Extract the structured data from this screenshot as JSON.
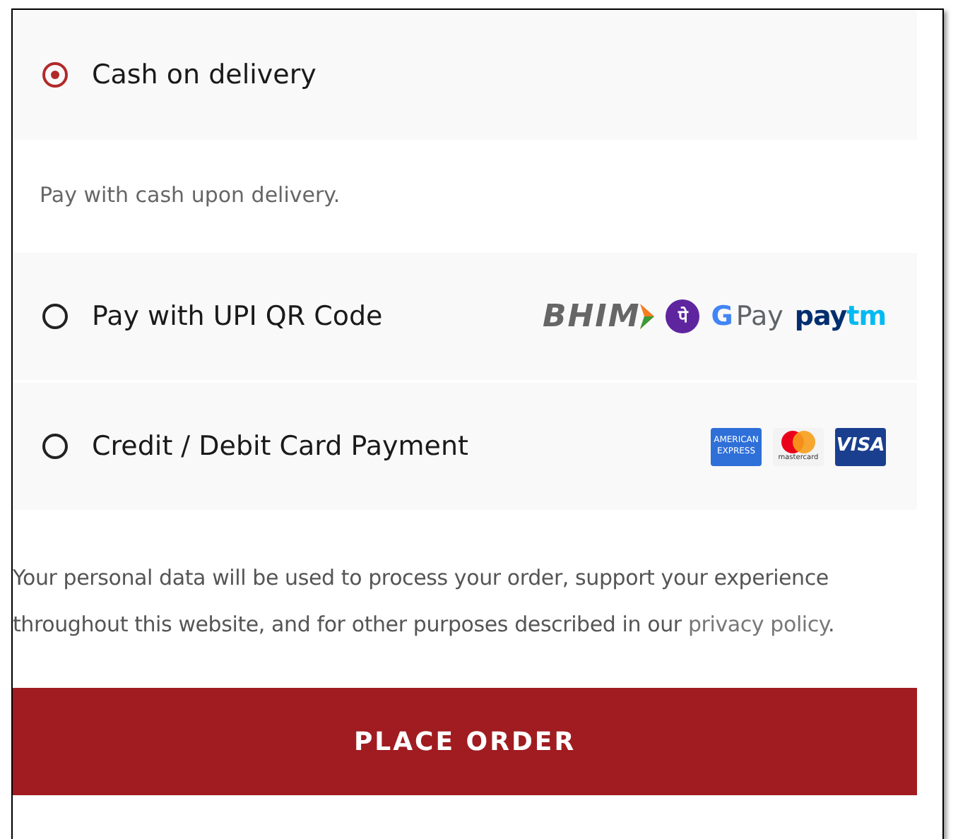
{
  "payment_methods": [
    {
      "label": "Cash on delivery",
      "selected": true,
      "description": "Pay with cash upon delivery."
    },
    {
      "label": "Pay with UPI QR Code",
      "selected": false,
      "logos": [
        {
          "kind": "bhim",
          "texts": [
            "BHIM"
          ]
        },
        {
          "kind": "phonepe",
          "texts": [
            "पे"
          ]
        },
        {
          "kind": "gpay",
          "texts": [
            "G",
            "Pay"
          ]
        },
        {
          "kind": "paytm",
          "texts": [
            "pay",
            "tm"
          ]
        }
      ]
    },
    {
      "label": "Credit / Debit Card Payment",
      "selected": false,
      "logos": [
        {
          "kind": "amex",
          "texts": [
            "AMERICAN",
            "EXPRESS"
          ]
        },
        {
          "kind": "mastercard",
          "texts": [
            "mastercard"
          ]
        },
        {
          "kind": "visa",
          "texts": [
            "VISA"
          ]
        }
      ]
    }
  ],
  "privacy_notice": {
    "text": "Your personal data will be used to process your order, support your experience throughout this website, and for other purposes described in our",
    "link": "privacy policy",
    "end": "."
  },
  "place_order_button": "PLACE ORDER"
}
